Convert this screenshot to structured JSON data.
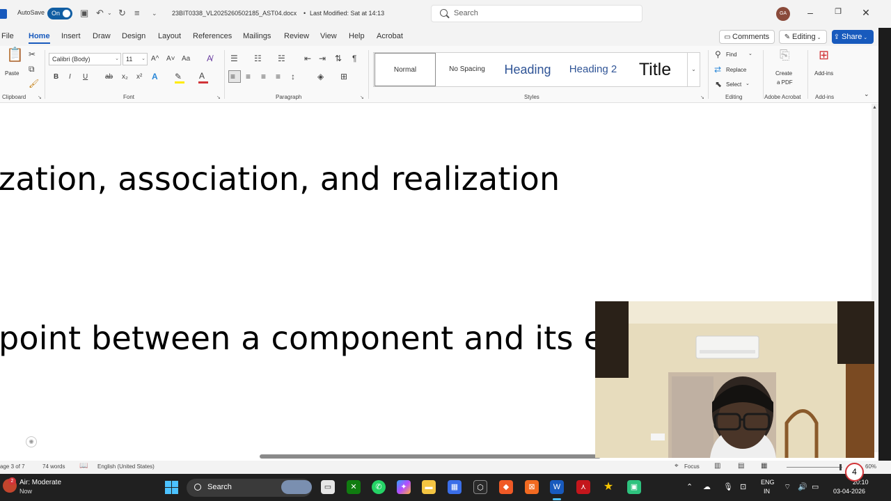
{
  "title_bar": {
    "autosave_label": "AutoSave",
    "autosave_state": "On",
    "doc_name": "23BIT0338_VL2025260502185_AST04.docx",
    "separator": "•",
    "last_modified": "Last Modified: Sat at 14:13",
    "search_placeholder": "Search",
    "avatar_initials": "GA",
    "brand_color": "#185abd"
  },
  "ribbon_tabs": {
    "file": "File",
    "home": "Home",
    "insert": "Insert",
    "draw": "Draw",
    "design": "Design",
    "layout": "Layout",
    "references": "References",
    "mailings": "Mailings",
    "review": "Review",
    "view": "View",
    "help": "Help",
    "acrobat": "Acrobat",
    "comments": "Comments",
    "editing": "Editing",
    "share": "Share"
  },
  "ribbon": {
    "clipboard": {
      "paste": "Paste",
      "label": "Clipboard"
    },
    "font": {
      "font_name": "Calibri (Body)",
      "font_size": "11",
      "case": "Aa",
      "label": "Font",
      "bold": "B",
      "italic": "I",
      "underline": "U",
      "strike": "ab",
      "subscript": "x₂",
      "superscript": "x²",
      "grow": "A^",
      "shrink": "A˅"
    },
    "paragraph": {
      "label": "Paragraph",
      "pilcrow": "¶"
    },
    "styles": {
      "label": "Styles",
      "normal": "Normal",
      "no_spacing": "No Spacing",
      "heading": "Heading",
      "heading2": "Heading 2",
      "title": "Title"
    },
    "editing_group": {
      "find": "Find",
      "replace": "Replace",
      "select": "Select",
      "label": "Editing"
    },
    "acrobat_group": {
      "create_pdf_1": "Create",
      "create_pdf_2": "a PDF",
      "label": "Adobe Acrobat"
    },
    "addins_group": {
      "addins": "Add-ins",
      "label": "Add-ins"
    }
  },
  "document": {
    "line1": "zation, association, and realization",
    "line2": "point between a component and its e"
  },
  "status_bar": {
    "page": "age 3 of 7",
    "words": "74 words",
    "language": "English (United States)",
    "focus": "Focus",
    "zoom": "60%"
  },
  "taskbar": {
    "weather_title": "Air: Moderate",
    "weather_sub": "Now",
    "weather_badge": "2",
    "search": "Search",
    "lang_top": "ENG",
    "lang_bottom": "IN",
    "time": "20:10",
    "date": "03-04-2026",
    "notification_count": "4"
  }
}
